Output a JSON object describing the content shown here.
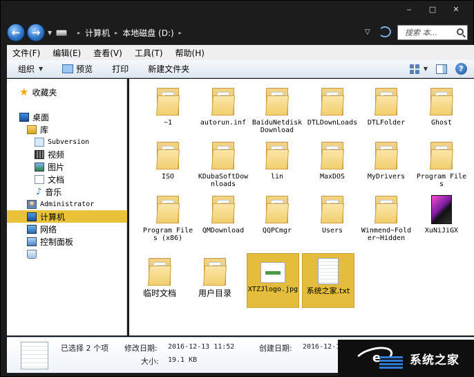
{
  "window": {
    "controls": {
      "minimize": "‒",
      "maximize": "□",
      "close": "✕"
    }
  },
  "address": {
    "back_icon": "back-arrow-icon",
    "forward_icon": "forward-arrow-icon",
    "crumbs": [
      "计算机",
      "本地磁盘 (D:)"
    ],
    "search_placeholder": "搜索 本..."
  },
  "menu": {
    "items": [
      "文件(F)",
      "编辑(E)",
      "查看(V)",
      "工具(T)",
      "帮助(H)"
    ]
  },
  "toolbar": {
    "organize": "组织",
    "preview": "预览",
    "print": "打印",
    "new_folder": "新建文件夹"
  },
  "nav": {
    "favorites": "收藏夹",
    "desktop": "桌面",
    "libraries": "库",
    "subversion": "Subversion",
    "videos": "视频",
    "pictures": "图片",
    "documents": "文档",
    "music": "音乐",
    "administrator": "Administrator",
    "computer": "计算机",
    "network": "网络",
    "control_panel": "控制面板"
  },
  "files": [
    {
      "name": "~1",
      "type": "folder"
    },
    {
      "name": "autorun.inf",
      "type": "folder"
    },
    {
      "name": "BaiduNetdiskDownload",
      "type": "folder"
    },
    {
      "name": "DTLDownLoads",
      "type": "folder"
    },
    {
      "name": "DTLFolder",
      "type": "folder"
    },
    {
      "name": "Ghost",
      "type": "folder"
    },
    {
      "name": "ISO",
      "type": "folder"
    },
    {
      "name": "KDubaSoftDownloads",
      "type": "folder"
    },
    {
      "name": "lin",
      "type": "folder"
    },
    {
      "name": "MaxDOS",
      "type": "folder"
    },
    {
      "name": "MyDrivers",
      "type": "folder"
    },
    {
      "name": "Program Files",
      "type": "folder"
    },
    {
      "name": "Program Files (x86)",
      "type": "folder"
    },
    {
      "name": "QMDownload",
      "type": "folder"
    },
    {
      "name": "QQPCmgr",
      "type": "folder"
    },
    {
      "name": "Users",
      "type": "folder"
    },
    {
      "name": "Winmend~Folder~Hidden",
      "type": "folder"
    },
    {
      "name": "XuNiJiGX",
      "type": "app"
    },
    {
      "name": "临时文档",
      "type": "folder"
    },
    {
      "name": "用户目录",
      "type": "folder"
    },
    {
      "name": "XTZJlogo.jpg",
      "type": "image",
      "selected": true
    },
    {
      "name": "系统之家.txt",
      "type": "text",
      "selected": true
    }
  ],
  "details": {
    "selected": "已选择 2 个项",
    "modified_label": "修改日期:",
    "modified_value": "2016-12-13 11:52",
    "created_label": "创建日期:",
    "created_value": "2016-12-1",
    "size_label": "大小:",
    "size_value": "19.1 KB"
  },
  "watermark": {
    "text": "系统之家"
  },
  "colors": {
    "selection": "#e3bd3b",
    "nav_selection": "#e9c239"
  }
}
